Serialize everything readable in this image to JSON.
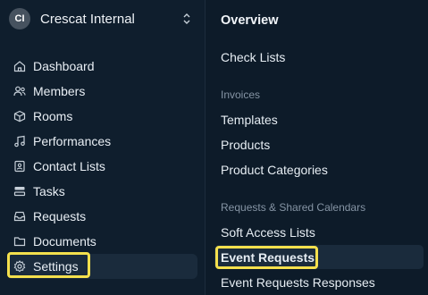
{
  "org": {
    "initials": "CI",
    "name": "Crescat Internal"
  },
  "sidebar": {
    "items": [
      {
        "label": "Dashboard",
        "icon": "home-icon"
      },
      {
        "label": "Members",
        "icon": "users-icon"
      },
      {
        "label": "Rooms",
        "icon": "cube-icon"
      },
      {
        "label": "Performances",
        "icon": "music-icon"
      },
      {
        "label": "Contact Lists",
        "icon": "contact-book-icon"
      },
      {
        "label": "Tasks",
        "icon": "tasks-icon"
      },
      {
        "label": "Requests",
        "icon": "inbox-icon"
      },
      {
        "label": "Documents",
        "icon": "folder-icon"
      },
      {
        "label": "Settings",
        "icon": "gear-icon",
        "active": true
      }
    ]
  },
  "settings_panel": {
    "title": "Overview",
    "check_lists": "Check Lists",
    "invoices_section": "Invoices",
    "templates": "Templates",
    "products": "Products",
    "product_categories": "Product Categories",
    "requests_section": "Requests & Shared Calendars",
    "soft_access_lists": "Soft Access Lists",
    "event_requests": "Event Requests",
    "event_requests_responses": "Event Requests Responses"
  },
  "colors": {
    "background": "#0f1e2d",
    "highlight": "#f4e04d",
    "active_row": "#1a2b3c"
  }
}
